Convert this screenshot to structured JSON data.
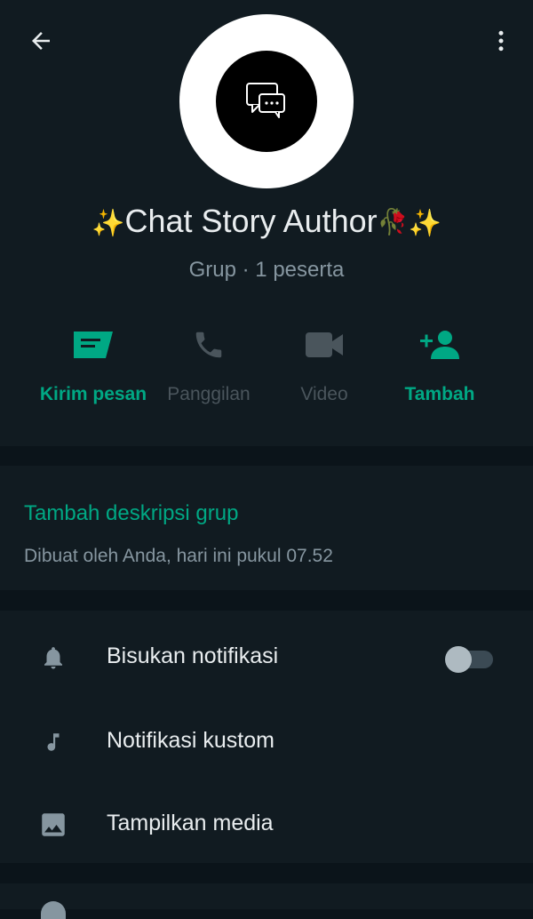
{
  "header": {
    "back_icon": "arrow-left-icon",
    "menu_icon": "more-vert-icon",
    "avatar_icon": "chat-bubbles-icon",
    "group_name": "Chat Story Author",
    "group_name_prefix": "✨",
    "group_name_suffix_emoji": "🥀",
    "group_name_suffix": "✨",
    "subtitle": "Grup · 1 peserta"
  },
  "actions": [
    {
      "label": "Kirim pesan",
      "icon": "message-icon",
      "state": "enabled"
    },
    {
      "label": "Panggilan",
      "icon": "phone-icon",
      "state": "disabled"
    },
    {
      "label": "Video",
      "icon": "videocam-icon",
      "state": "disabled"
    },
    {
      "label": "Tambah",
      "icon": "person-add-icon",
      "state": "enabled"
    }
  ],
  "description": {
    "add_label": "Tambah deskripsi grup",
    "created_text": "Dibuat oleh Anda, hari ini pukul 07.52"
  },
  "settings": [
    {
      "label": "Bisukan notifikasi",
      "icon": "bell-icon",
      "toggle": false
    },
    {
      "label": "Notifikasi kustom",
      "icon": "music-note-icon"
    },
    {
      "label": "Tampilkan media",
      "icon": "image-icon"
    }
  ],
  "colors": {
    "background": "#0b141a",
    "panel": "#111b21",
    "accent": "#00a884",
    "primary_text": "#e9edef",
    "secondary_text": "#8696a0",
    "disabled_text": "#4a555c"
  }
}
